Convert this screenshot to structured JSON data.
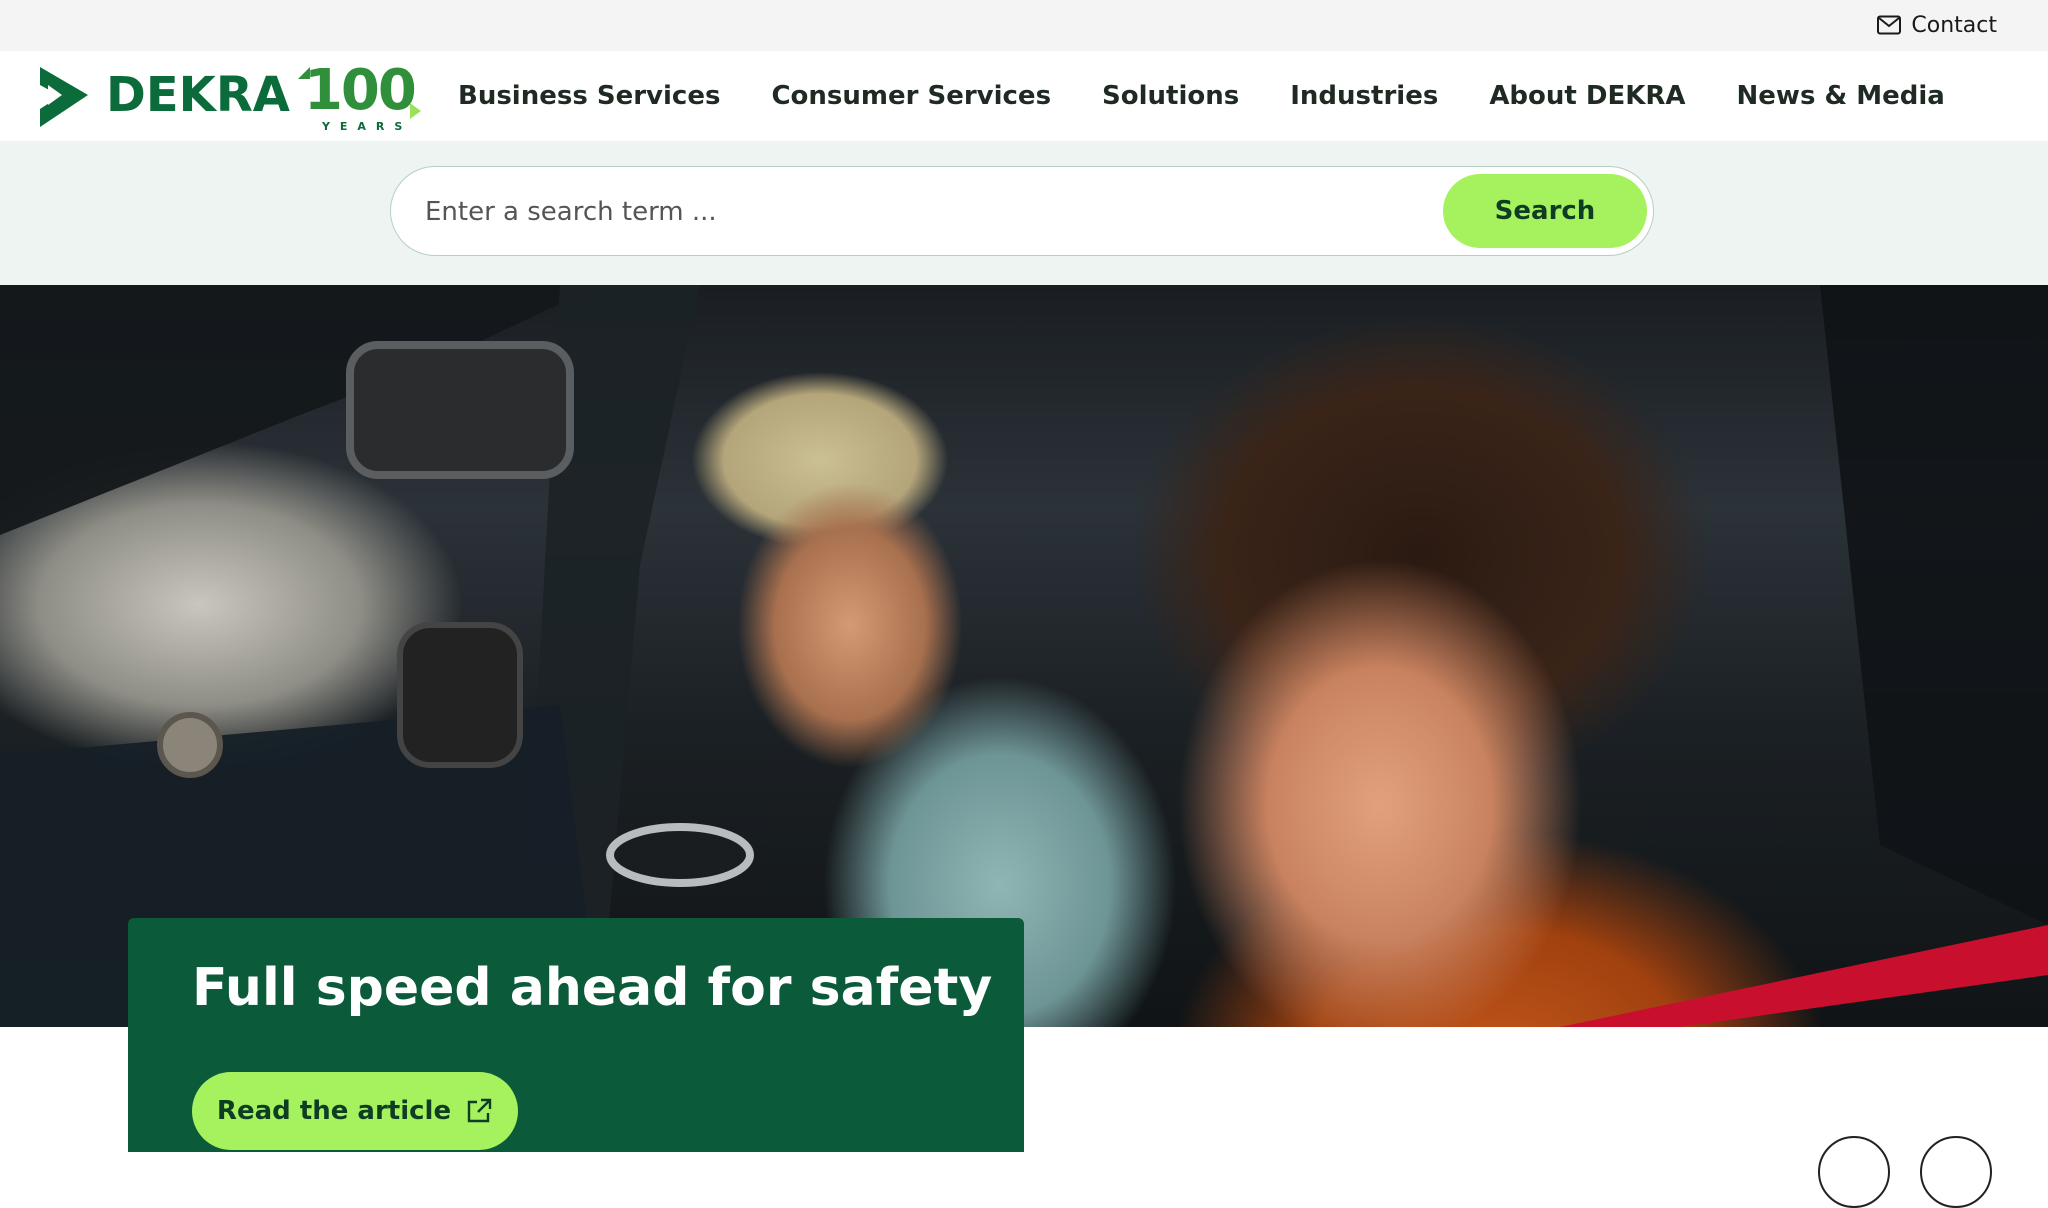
{
  "topbar": {
    "contact_label": "Contact",
    "contact_icon": "mail-icon"
  },
  "brand": {
    "wordmark": "DEKRA",
    "anniversary_number": "100",
    "anniversary_label": "YEARS",
    "color_primary": "#0b6b3a",
    "color_accent": "#a5f25e"
  },
  "nav": {
    "items": [
      {
        "label": "Business Services"
      },
      {
        "label": "Consumer Services"
      },
      {
        "label": "Solutions"
      },
      {
        "label": "Industries"
      },
      {
        "label": "About DEKRA"
      },
      {
        "label": "News & Media"
      }
    ]
  },
  "search": {
    "placeholder": "Enter a search term ...",
    "value": "",
    "button_label": "Search"
  },
  "hero": {
    "image_icon": "hero-photo",
    "teaser": {
      "title": "Full speed ahead for safety",
      "button_label": "Read the article",
      "button_icon": "external-link-icon",
      "background": "#0b5a3a"
    }
  },
  "carousel": {
    "prev_icon": "chevron-left-icon",
    "next_icon": "chevron-right-icon"
  }
}
